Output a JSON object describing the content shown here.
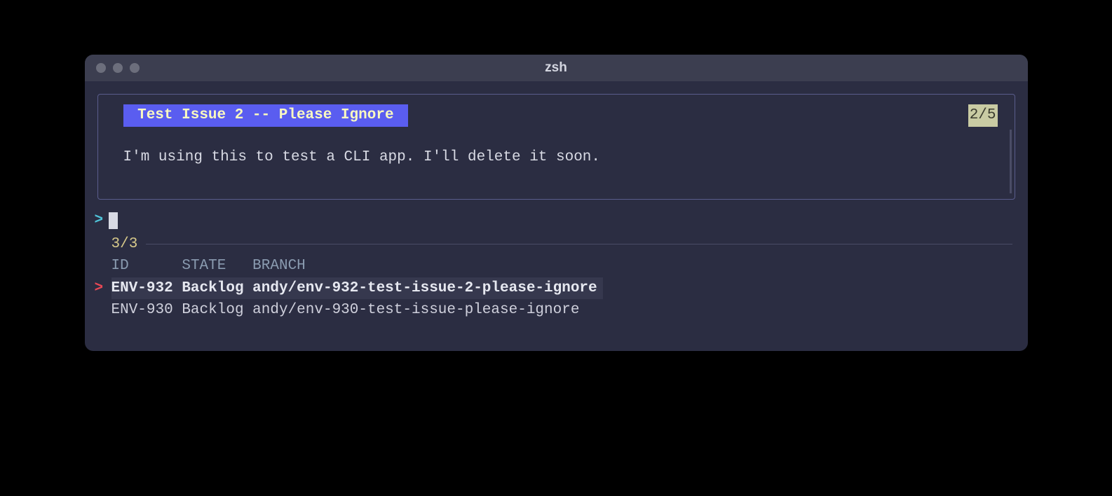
{
  "window": {
    "title": "zsh"
  },
  "preview": {
    "title": " Test Issue 2 -- Please Ignore ",
    "index": "2/5",
    "description": "I'm using this to test a CLI app. I'll delete it soon."
  },
  "prompt": {
    "symbol": ">"
  },
  "counter": "3/3",
  "table": {
    "headers": {
      "id": "ID",
      "state": "STATE",
      "branch": "BRANCH"
    },
    "rows": [
      {
        "id": "ENV-932",
        "state": "Backlog",
        "branch": "andy/env-932-test-issue-2-please-ignore",
        "selected": true
      },
      {
        "id": "ENV-930",
        "state": "Backlog",
        "branch": "andy/env-930-test-issue-please-ignore",
        "selected": false
      }
    ]
  },
  "pointer": ">"
}
